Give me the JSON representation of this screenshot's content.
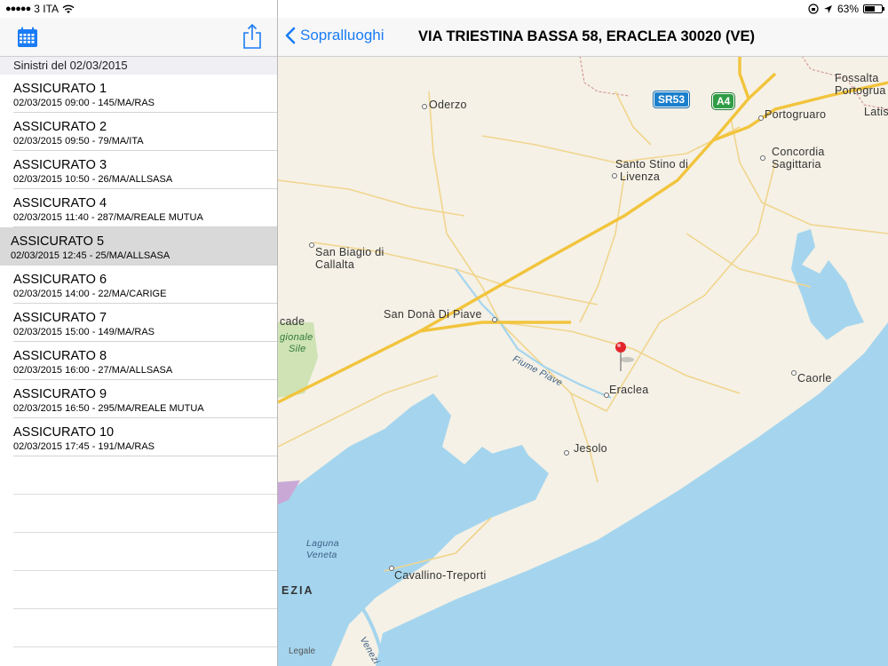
{
  "status": {
    "carrier": "3 ITA",
    "battery": "63%",
    "battery_level": 0.63
  },
  "left": {
    "section_header": "Sinistri del 02/03/2015",
    "selected_index": 4,
    "items": [
      {
        "title": "ASSICURATO 1",
        "subtitle": "02/03/2015 09:00 - 145/MA/RAS"
      },
      {
        "title": "ASSICURATO 2",
        "subtitle": "02/03/2015 09:50 - 79/MA/ITA"
      },
      {
        "title": "ASSICURATO 3",
        "subtitle": "02/03/2015 10:50 - 26/MA/ALLSASA"
      },
      {
        "title": "ASSICURATO 4",
        "subtitle": "02/03/2015 11:40 - 287/MA/REALE MUTUA"
      },
      {
        "title": "ASSICURATO 5",
        "subtitle": "02/03/2015 12:45 - 25/MA/ALLSASA"
      },
      {
        "title": "ASSICURATO 6",
        "subtitle": "02/03/2015 14:00 - 22/MA/CARIGE"
      },
      {
        "title": "ASSICURATO 7",
        "subtitle": "02/03/2015 15:00 - 149/MA/RAS"
      },
      {
        "title": "ASSICURATO 8",
        "subtitle": "02/03/2015 16:00 - 27/MA/ALLSASA"
      },
      {
        "title": "ASSICURATO 9",
        "subtitle": "02/03/2015 16:50 - 295/MA/REALE MUTUA"
      },
      {
        "title": "ASSICURATO 10",
        "subtitle": "02/03/2015 17:45 - 191/MA/RAS"
      }
    ]
  },
  "nav": {
    "back_label": "Sopralluoghi",
    "title": "VIA TRIESTINA BASSA 58, ERACLEA 30020 (VE)"
  },
  "map": {
    "labels": {
      "oderzo": "Oderzo",
      "portogruaro": "Portogruaro",
      "fossalta_1": "Fossalta",
      "fossalta_2": "Portogrua",
      "latis": "Latis",
      "concordia_1": "Concordia",
      "concordia_2": "Sagittaria",
      "santo_stino_1": "Santo Stino di",
      "santo_stino_2": "Livenza",
      "san_biagio_1": "San Biagio di",
      "san_biagio_2": "Callalta",
      "san_dona": "San Donà Di Piave",
      "cade": "cade",
      "park_1": "gionale",
      "park_2": "Sile",
      "fiume_piave": "Fiume Piave",
      "eraclea": "Eraclea",
      "caorle": "Caorle",
      "jesolo": "Jesolo",
      "laguna_1": "Laguna",
      "laguna_2": "Veneta",
      "cavallino": "Cavallino-Treporti",
      "venezia": "EZIA",
      "venezia_canal": "Venezi",
      "legal": "Legale"
    },
    "shields": {
      "sr53": "SR53",
      "a4": "A4"
    },
    "colors": {
      "land": "#f5f1e6",
      "water": "#a5d5ee",
      "highway": "#f2c43c",
      "road": "#f1d58d",
      "pin": "#e3242b"
    }
  }
}
